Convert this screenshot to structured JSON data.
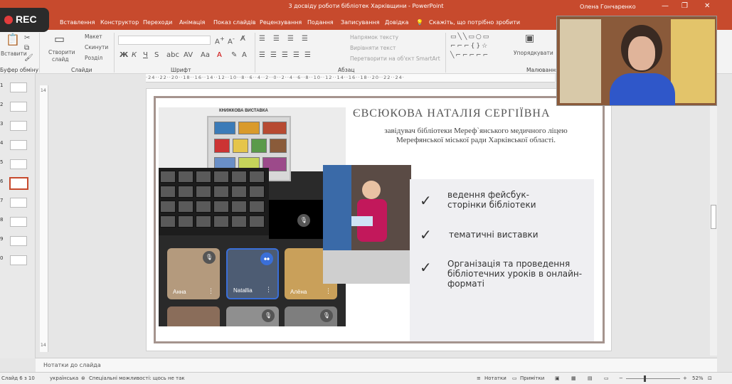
{
  "window": {
    "title": "3 досвіду роботи бібліотек Харківщини  -  PowerPoint",
    "user": "Олена Гончаренко",
    "minimize": "—",
    "restore": "❐",
    "close": "✕"
  },
  "recording": {
    "label": "REC",
    "color": "#e23c3c"
  },
  "tabs": [
    "Вставлення",
    "Конструктор",
    "Переходи",
    "Анімація",
    "Показ слайдів",
    "Рецензування",
    "Подання",
    "Записування",
    "Довідка",
    "Скажіть, що потрібно зробити"
  ],
  "ribbon": {
    "clipboard": {
      "paste": "Вставити",
      "label": "Буфер обміну"
    },
    "slides": {
      "new_slide_1": "Створити",
      "new_slide_2": "слайд",
      "layout": "Макет",
      "reset": "Скинути",
      "section": "Розділ",
      "label": "Слайди"
    },
    "font": {
      "label": "Шрифт"
    },
    "paragraph": {
      "text_direction": "Напрямок тексту",
      "align_text": "Вирівняти текст",
      "smartart": "Перетворити на об'єкт SmartArt",
      "label": "Абзац"
    },
    "drawing": {
      "arrange": "Упорядкувати",
      "label": "Малювання"
    }
  },
  "ruler": {
    "numbers": "·24··22··20··18··16··14··12··10··8··6··4··2··0··2··4··6··8··10··12··14··16··18··20··22··24·"
  },
  "vruler": {
    "top": "14",
    "bottom": "14"
  },
  "thumbnails": [
    {
      "num": "1"
    },
    {
      "num": "2"
    },
    {
      "num": "3"
    },
    {
      "num": "4"
    },
    {
      "num": "5"
    },
    {
      "num": "6",
      "active": true
    },
    {
      "num": "7"
    },
    {
      "num": "8"
    },
    {
      "num": "9"
    },
    {
      "num": "0"
    }
  ],
  "slide": {
    "name": "ЄВСЮКОВА НАТАЛІЯ СЕРГІЇВНА",
    "role": "завідувач бібліотеки Мереф`янського медичного ліцею Мерефянської міської ради Харківської області.",
    "poster_title": "КНИЖКОВА ВИСТАВКА",
    "bullets": [
      "ведення фейсбук-сторінки бібліотеки",
      "тематичні виставки",
      "Організація та проведення бібліотечних уроків в онлайн-форматі"
    ],
    "bullet_check": "✓",
    "participants": [
      "Анна",
      "Natallia",
      "Алёна"
    ],
    "mute_icon": "🎙"
  },
  "notes": {
    "placeholder": "Нотатки до слайда"
  },
  "status": {
    "slide_counter": "Слайд 6 з 10",
    "language": "українська",
    "accessibility": "Спеціальні можливості: щось не так",
    "notes_btn": "Нотатки",
    "comments_btn": "Примітки",
    "zoom": "52%",
    "zoom_minus": "−",
    "zoom_plus": "+"
  },
  "colors": {
    "accent": "#c74a2d",
    "frame": "#a5948e"
  }
}
